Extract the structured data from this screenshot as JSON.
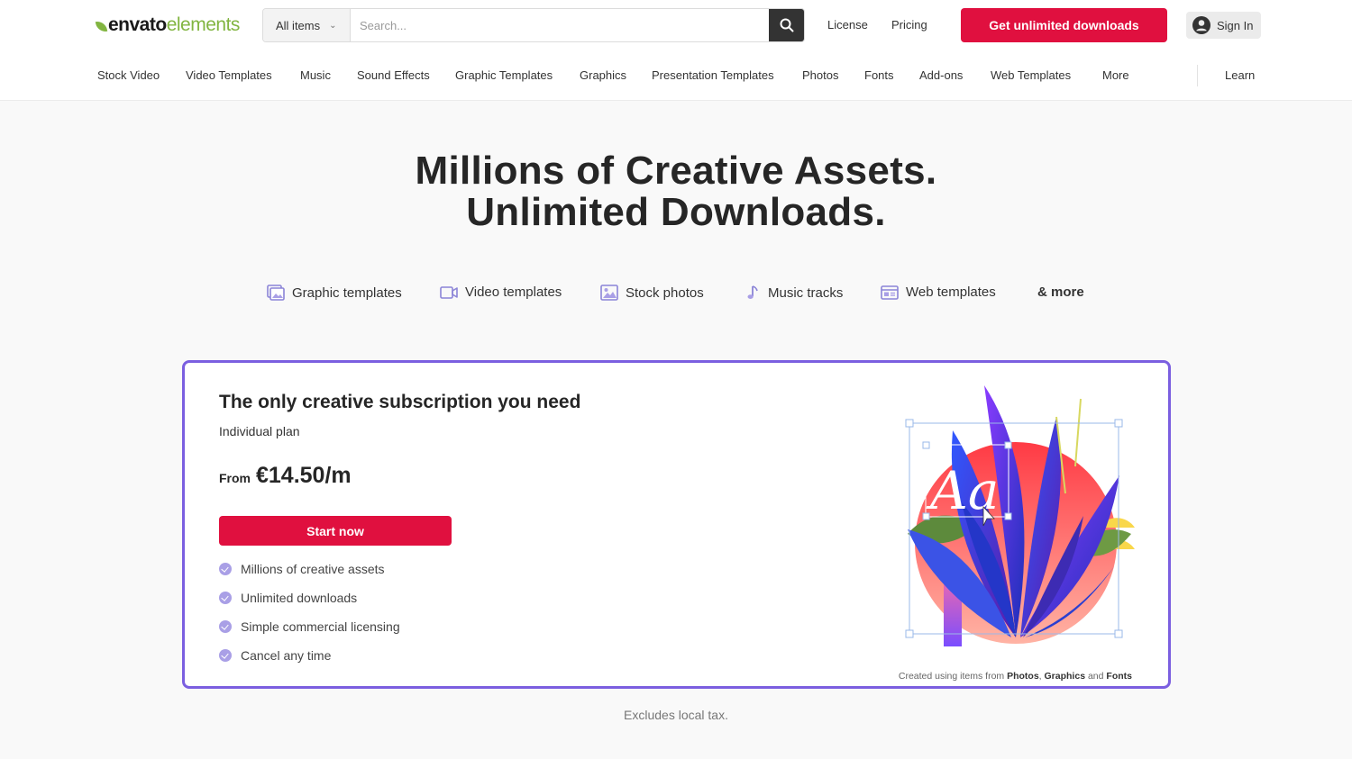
{
  "brand": {
    "name_part1": "envato",
    "name_part2": "elements",
    "accent": "#82b541",
    "cta_color": "#e0103f",
    "card_border": "#7b5fe0"
  },
  "search": {
    "category": "All items",
    "placeholder": "Search...",
    "icon": "search-icon"
  },
  "header": {
    "license": "License",
    "pricing": "Pricing",
    "cta": "Get unlimited downloads",
    "signin": "Sign In"
  },
  "nav": {
    "items": [
      "Stock Video",
      "Video Templates",
      "Music",
      "Sound Effects",
      "Graphic Templates",
      "Graphics",
      "Presentation Templates",
      "Photos",
      "Fonts",
      "Add-ons",
      "Web Templates",
      "More"
    ],
    "learn": "Learn"
  },
  "hero": {
    "line1": "Millions of Creative Assets.",
    "line2": "Unlimited Downloads."
  },
  "categories": {
    "items": [
      {
        "label": "Graphic templates",
        "icon": "graphic-templates-icon"
      },
      {
        "label": "Video templates",
        "icon": "video-icon"
      },
      {
        "label": "Stock photos",
        "icon": "photo-icon"
      },
      {
        "label": "Music tracks",
        "icon": "music-note-icon"
      },
      {
        "label": "Web templates",
        "icon": "web-template-icon"
      }
    ],
    "more": "& more"
  },
  "plan": {
    "title": "The only creative subscription you need",
    "subtitle": "Individual plan",
    "from": "From",
    "price": "€14.50/m",
    "button": "Start now",
    "features": [
      "Millions of creative assets",
      "Unlimited downloads",
      "Simple commercial licensing",
      "Cancel any time"
    ],
    "credit_prefix": "Created using items from",
    "credit_1": "Photos",
    "credit_sep1": ",",
    "credit_2": "Graphics",
    "credit_and": "and",
    "credit_3": "Fonts",
    "art_text": "Aa"
  },
  "footer_note": "Excludes local tax."
}
